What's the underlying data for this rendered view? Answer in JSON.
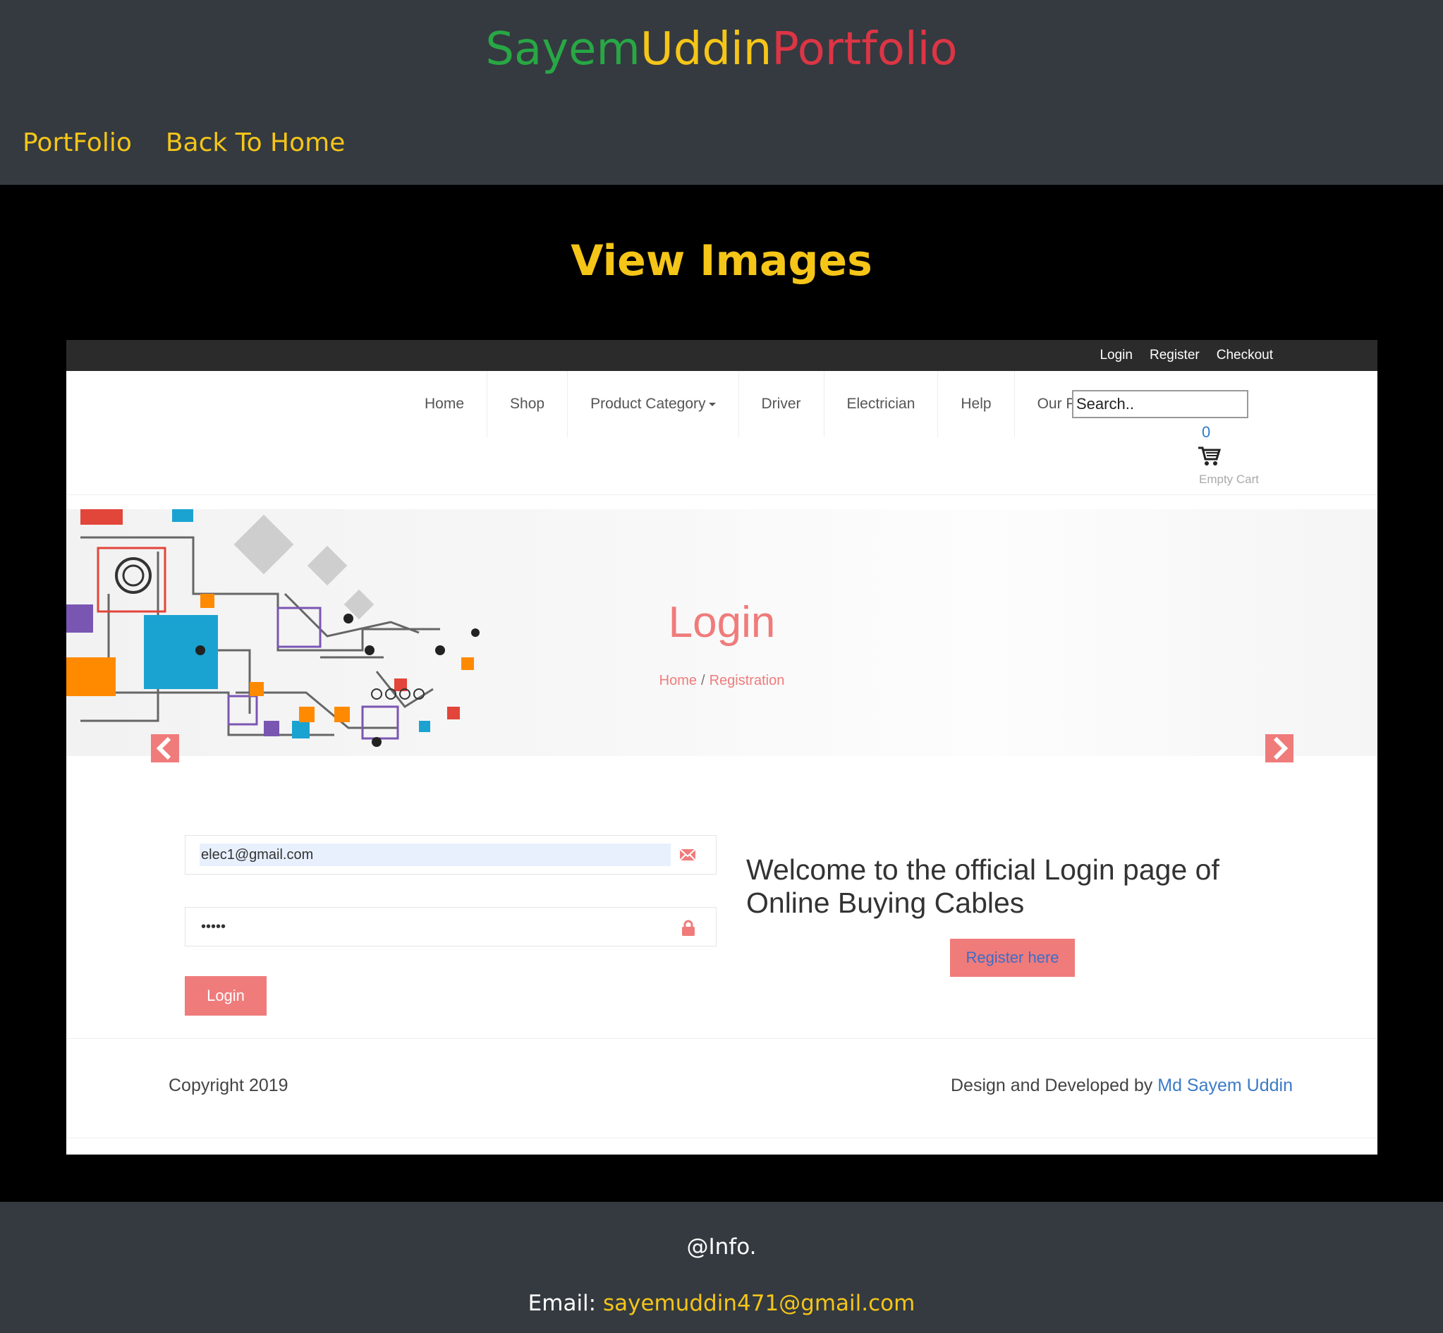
{
  "header": {
    "brand_part1": "Sayem",
    "brand_part2": "Uddin",
    "brand_part3": "Portfolio",
    "brand_colors": [
      "#28a745",
      "#f5c518",
      "#dc3545"
    ],
    "nav": [
      {
        "label": "PortFolio"
      },
      {
        "label": "Back To Home"
      }
    ],
    "nav_color": "#f5c518",
    "background": "#343a40"
  },
  "main": {
    "title": "View Images",
    "title_color": "#f5c518"
  },
  "screenshot": {
    "topbar_links": [
      "Login",
      "Register",
      "Checkout"
    ],
    "nav_items": [
      "Home",
      "Shop",
      "Product Category",
      "Driver",
      "Electrician",
      "Help",
      "Our Policy"
    ],
    "search_placeholder": "Search..",
    "cart_count": "0",
    "cart_label": "Empty Cart",
    "banner_title": "Login",
    "breadcrumb_home": "Home",
    "breadcrumb_sep": "/",
    "breadcrumb_current": "Registration",
    "email_value": "elec1@gmail.com",
    "password_value": "•••••",
    "login_button": "Login",
    "welcome_text": "Welcome to the official Login page of Online Buying Cables",
    "register_button": "Register here",
    "copyright": "Copyright 2019",
    "credit_prefix": "Design and Developed by ",
    "credit_name": "Md Sayem Uddin",
    "accent_color": "#f07b7b",
    "icons": [
      "envelope-icon",
      "lock-icon",
      "cart-icon",
      "chevron-left-icon",
      "chevron-right-icon",
      "caret-down-icon"
    ]
  },
  "footer": {
    "heading": "@Info.",
    "email_label": "Email: ",
    "email": "sayemuddin471@gmail.com"
  }
}
